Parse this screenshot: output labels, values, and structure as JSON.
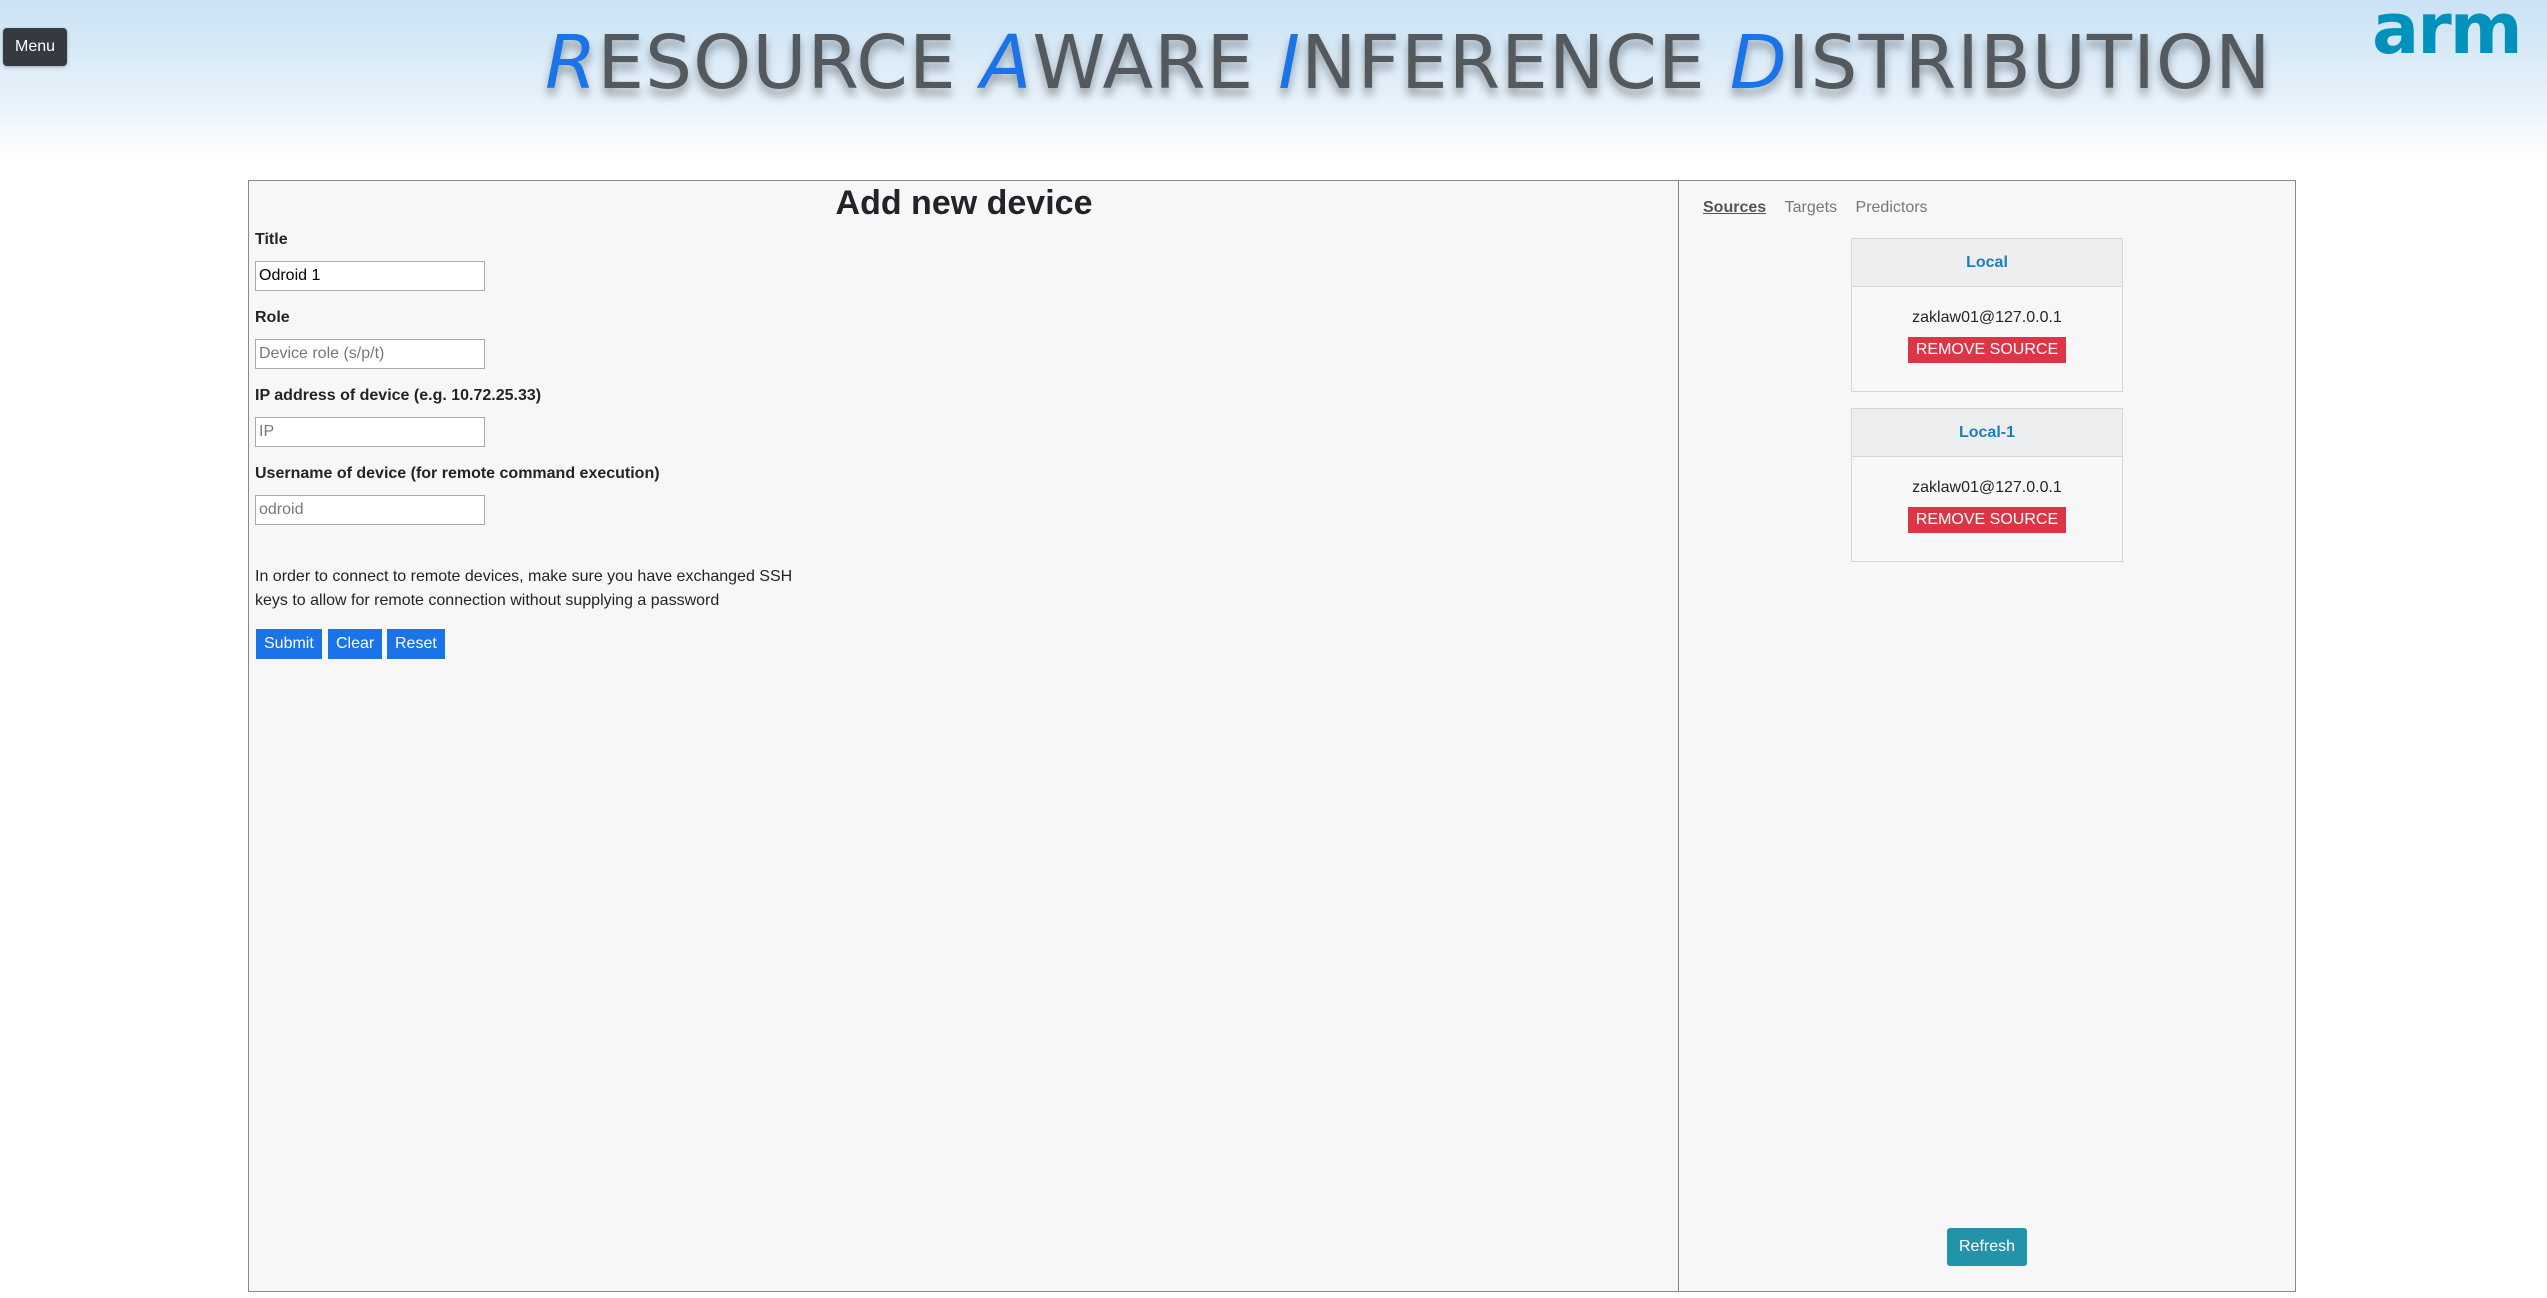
{
  "header": {
    "menu_label": "Menu",
    "title_words": [
      {
        "initial": "R",
        "rest": "ESOURCE"
      },
      {
        "initial": "A",
        "rest": "WARE"
      },
      {
        "initial": "I",
        "rest": "NFERENCE"
      },
      {
        "initial": "D",
        "rest": "ISTRIBUTION"
      }
    ],
    "logo_text": "arm"
  },
  "form": {
    "title": "Add new device",
    "fields": [
      {
        "label": "Title",
        "value": "Odroid 1",
        "placeholder": ""
      },
      {
        "label": "Role",
        "value": "",
        "placeholder": "Device role (s/p/t)"
      },
      {
        "label": "IP address of device (e.g. 10.72.25.33)",
        "value": "",
        "placeholder": "IP"
      },
      {
        "label": "Username of device (for remote command execution)",
        "value": "",
        "placeholder": "odroid"
      }
    ],
    "note": "In order to connect to remote devices, make sure you have exchanged SSH keys to allow for remote connection without supplying a password",
    "buttons": {
      "submit": "Submit",
      "clear": "Clear",
      "reset": "Reset"
    }
  },
  "sidebar": {
    "tabs": [
      {
        "label": "Sources",
        "active": true
      },
      {
        "label": "Targets",
        "active": false
      },
      {
        "label": "Predictors",
        "active": false
      }
    ],
    "cards": [
      {
        "title": "Local",
        "address": "zaklaw01@127.0.0.1",
        "button": "REMOVE SOURCE"
      },
      {
        "title": "Local-1",
        "address": "zaklaw01@127.0.0.1",
        "button": "REMOVE SOURCE"
      }
    ],
    "refresh_label": "Refresh"
  },
  "colors": {
    "accent": "#1a73e8",
    "danger": "#dc3545",
    "teal": "#2293a8",
    "arm_blue": "#0091bd"
  }
}
